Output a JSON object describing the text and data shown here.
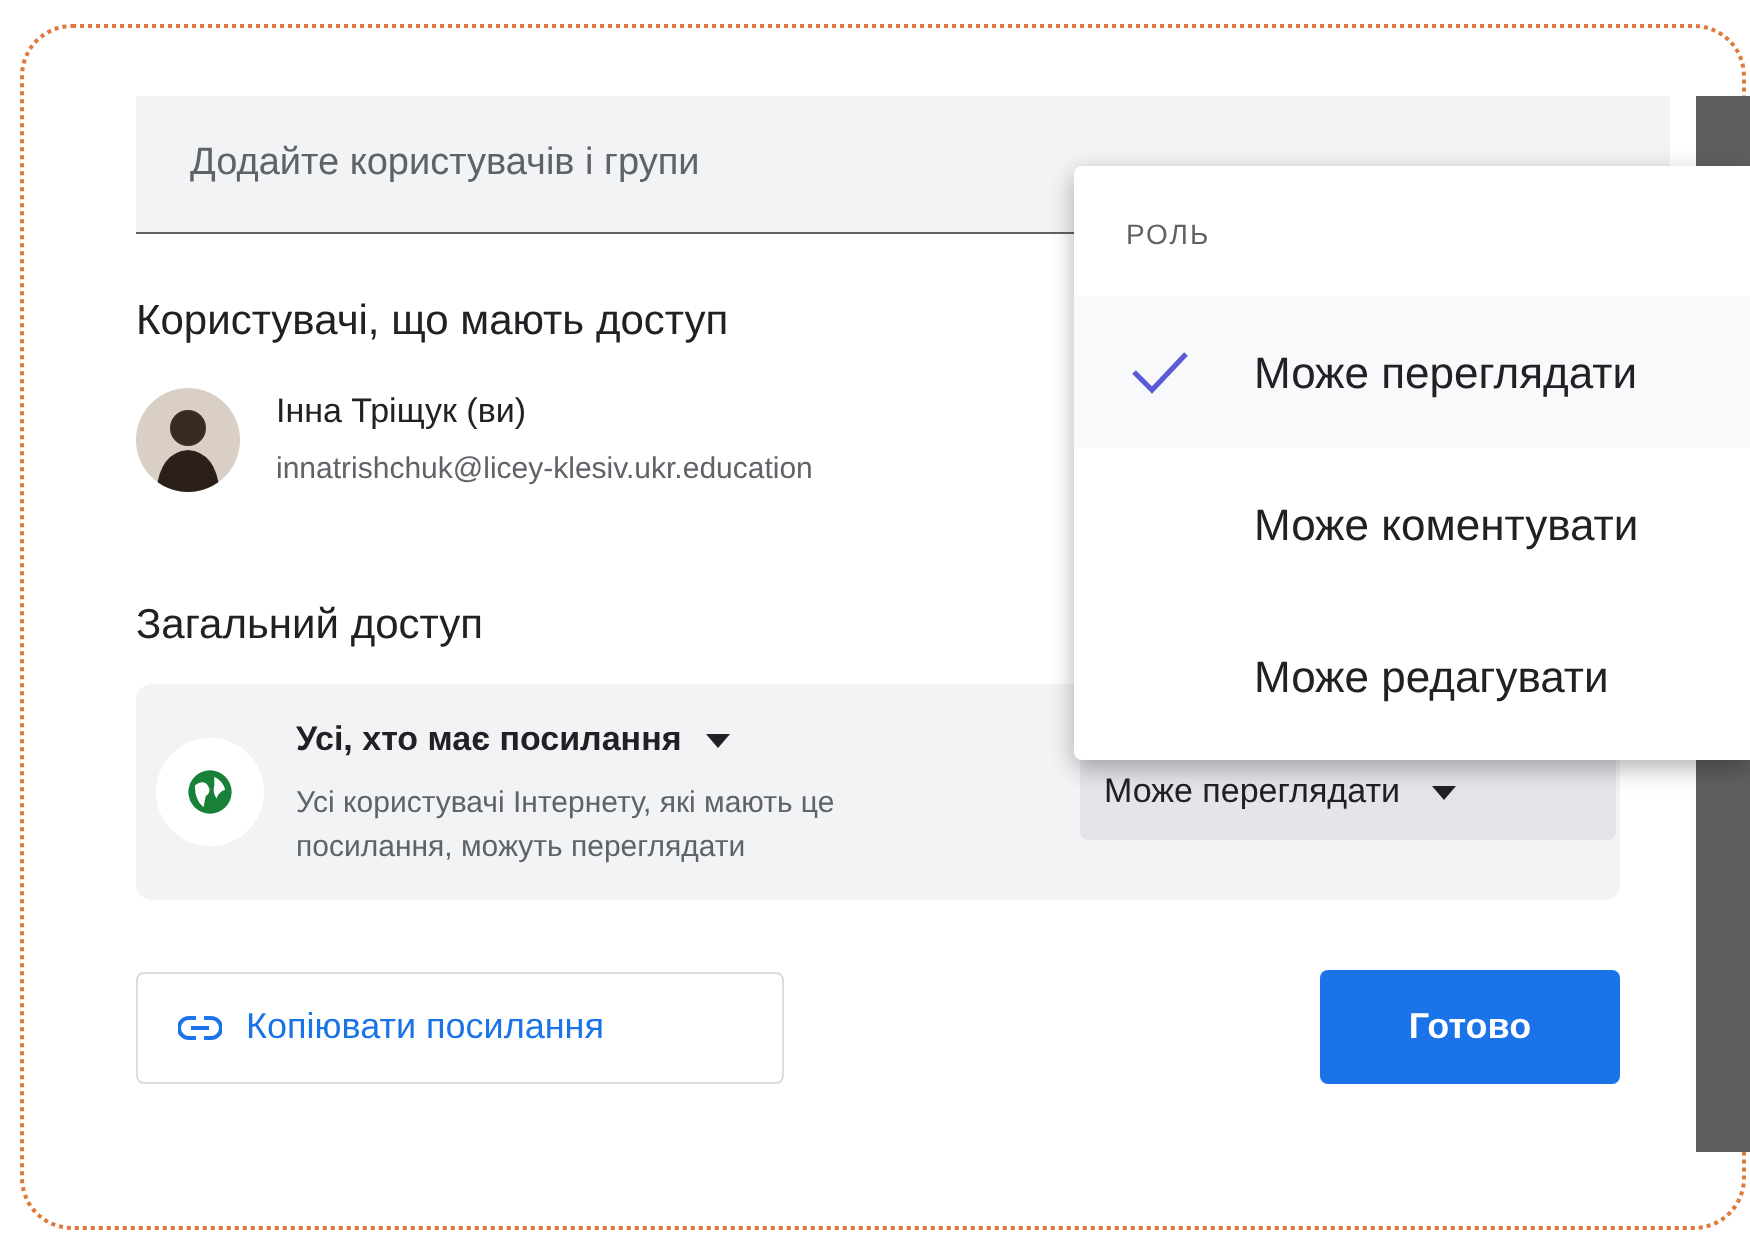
{
  "add_people": {
    "placeholder": "Додайте користувачів і групи"
  },
  "people_heading": "Користувачі, що мають доступ",
  "people": [
    {
      "name": "Інна Тріщук (ви)",
      "email": "innatrishchuk@licey-klesiv.ukr.education"
    }
  ],
  "general_access": {
    "heading": "Загальний доступ",
    "scope": "Усі, хто має посилання",
    "description": "Усі користувачі Інтернету, які мають це посилання, можуть переглядати",
    "role": "Може переглядати"
  },
  "role_menu": {
    "label": "РОЛЬ",
    "options": [
      {
        "label": "Може переглядати",
        "selected": true
      },
      {
        "label": "Може коментувати",
        "selected": false
      },
      {
        "label": "Може редагувати",
        "selected": false
      }
    ]
  },
  "copy_link_button": "Копіювати посилання",
  "done_button": "Готово"
}
